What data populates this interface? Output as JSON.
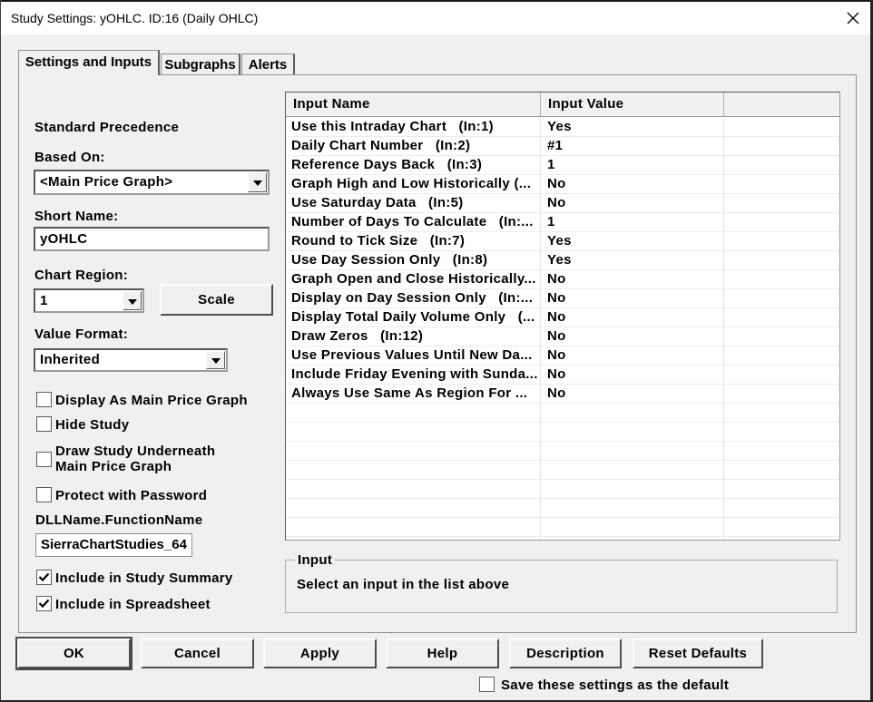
{
  "window": {
    "title": "Study Settings: yOHLC. ID:16 (Daily OHLC)"
  },
  "tabs": [
    {
      "label": "Settings and Inputs",
      "active": true
    },
    {
      "label": "Subgraphs",
      "active": false
    },
    {
      "label": "Alerts",
      "active": false
    }
  ],
  "left_panel": {
    "section_label": "Standard Precedence",
    "based_on": {
      "label": "Based On:",
      "value": "<Main Price Graph>"
    },
    "short_name": {
      "label": "Short Name:",
      "value": "yOHLC"
    },
    "chart_region": {
      "label": "Chart Region:",
      "value": "1"
    },
    "scale_button": "Scale",
    "value_format": {
      "label": "Value Format:",
      "value": "Inherited"
    },
    "checkboxes": [
      {
        "label": "Display As Main Price Graph",
        "checked": false
      },
      {
        "label": "Hide Study",
        "checked": false
      },
      {
        "label": "Draw Study Underneath\nMain Price Graph",
        "checked": false
      },
      {
        "label": "Protect with Password",
        "checked": false
      },
      {
        "label": "Include in Study Summary",
        "checked": true
      },
      {
        "label": "Include in Spreadsheet",
        "checked": true
      }
    ],
    "dll_label": "DLLName.FunctionName",
    "dll_value": "SierraChartStudies_64"
  },
  "inputs_table": {
    "columns": [
      "Input Name",
      "Input Value",
      ""
    ],
    "rows": [
      {
        "name": "Use this Intraday Chart   (In:1)",
        "value": "Yes"
      },
      {
        "name": "Daily Chart Number   (In:2)",
        "value": "#1"
      },
      {
        "name": "Reference Days Back   (In:3)",
        "value": "1"
      },
      {
        "name": "Graph High and Low Historically (...",
        "value": "No"
      },
      {
        "name": "Use Saturday Data   (In:5)",
        "value": "No"
      },
      {
        "name": "Number of Days To Calculate   (In:...",
        "value": "1"
      },
      {
        "name": "Round to Tick Size   (In:7)",
        "value": "Yes"
      },
      {
        "name": "Use Day Session Only   (In:8)",
        "value": "Yes"
      },
      {
        "name": "Graph Open and Close Historically...",
        "value": "No"
      },
      {
        "name": "Display on Day Session Only   (In:...",
        "value": "No"
      },
      {
        "name": "Display Total Daily Volume Only   (...",
        "value": "No"
      },
      {
        "name": "Draw Zeros   (In:12)",
        "value": "No"
      },
      {
        "name": "Use Previous Values Until New Da...",
        "value": "No"
      },
      {
        "name": "Include Friday Evening with Sunda...",
        "value": "No"
      },
      {
        "name": "Always Use Same As Region For ...",
        "value": "No"
      }
    ]
  },
  "input_group": {
    "title": "Input",
    "message": "Select an input in the list above"
  },
  "footer": {
    "buttons": [
      "OK",
      "Cancel",
      "Apply",
      "Help",
      "Description",
      "Reset Defaults"
    ],
    "save_checkbox": {
      "label": "Save these settings as the default",
      "checked": false
    }
  }
}
